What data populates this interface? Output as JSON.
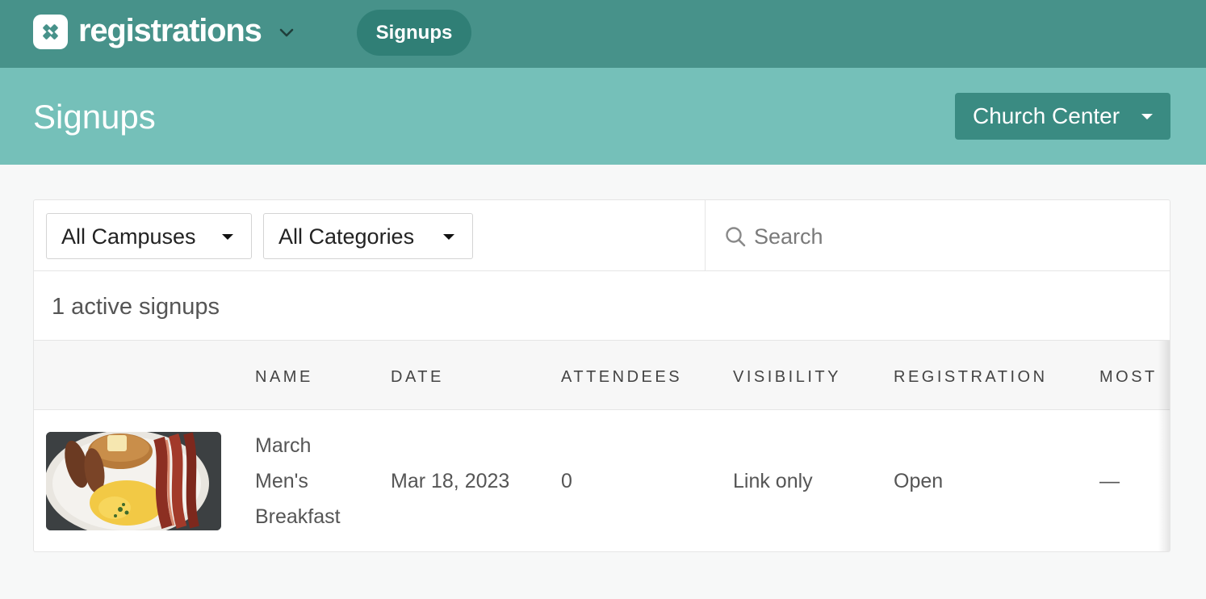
{
  "app": {
    "name": "registrations",
    "nav_pill_label": "Signups"
  },
  "header": {
    "title": "Signups",
    "org_button_label": "Church Center"
  },
  "filters": {
    "campus_select": "All Campuses",
    "category_select": "All Categories",
    "search_placeholder": "Search",
    "search_value": ""
  },
  "summary": {
    "count_text": "1 active signups"
  },
  "table": {
    "columns": [
      "NAME",
      "DATE",
      "ATTENDEES",
      "VISIBILITY",
      "REGISTRATION",
      "MOST"
    ],
    "rows": [
      {
        "image_icon": "breakfast-photo",
        "name": "March Men's Breakfast",
        "date": "Mar 18, 2023",
        "attendees": "0",
        "visibility": "Link only",
        "registration": "Open",
        "most": "—"
      }
    ]
  },
  "colors": {
    "nav_bg": "#47928a",
    "nav_pill_bg": "#307f76",
    "header_bg": "#75c0b9",
    "org_button_bg": "#3a8b82",
    "page_bg": "#f7f8f8"
  },
  "icons": {
    "logo": "registrations-logo-icon",
    "app_menu": "chevron-down-icon",
    "org_dropdown": "caret-down-icon",
    "search": "search-icon"
  }
}
